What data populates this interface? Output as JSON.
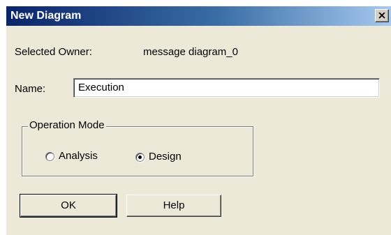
{
  "window": {
    "title": "New Diagram",
    "close_icon": "close-icon"
  },
  "owner": {
    "label": "Selected Owner:",
    "value": "message diagram_0"
  },
  "name": {
    "label": "Name:",
    "value": "Execution"
  },
  "operation_mode": {
    "legend": "Operation Mode",
    "options": [
      {
        "label": "Analysis",
        "selected": false
      },
      {
        "label": "Design",
        "selected": true
      }
    ]
  },
  "buttons": {
    "ok_label": "OK",
    "help_label": "Help"
  },
  "colors": {
    "title_start": "#0a246a",
    "title_end": "#a6caf0",
    "dialog_bg": "#ece9d8"
  }
}
